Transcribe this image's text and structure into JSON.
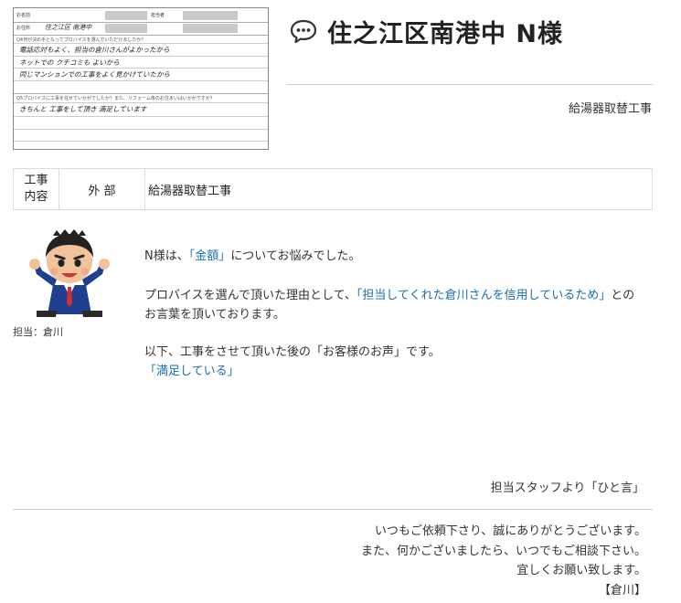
{
  "survey": {
    "q1_label": "Q4何が決め手となってプロバイスを選んでいただけましたか？",
    "answer1_line1": "電話応対もよく、担当の倉川さんがよかったから",
    "answer1_line2": "ネットでの クチコミも よいから",
    "answer1_line3": "同じマンションでの工事をよく見かけていたから",
    "q2_label": "Q5プロバイスに工事を任せていかがでしたか？また、リフォーム後のお住まいはいかがですか？",
    "answer2_line1": "きちんと 工事をして頂き 満足しています",
    "name_label": "お名前",
    "address_label": "お住所",
    "address_value": "住之江区 南港中",
    "contractor_label": "担当者"
  },
  "header": {
    "title": "住之江区南港中 N様",
    "work_type": "給湯器取替工事"
  },
  "info_table": {
    "label_line1": "工事",
    "label_line2": "内容",
    "category": "外 部",
    "detail": "給湯器取替工事"
  },
  "staff": {
    "caption": "担当：倉川"
  },
  "message": {
    "p1_pre": "N様は、",
    "p1_blue": "「金額」",
    "p1_post": "についてお悩みでした。",
    "p2_pre": "プロバイスを選んで頂いた理由として、",
    "p2_blue": "「担当してくれた倉川さんを信用しているため」",
    "p2_post": "との",
    "p2_line2": "お言葉を頂いております。",
    "p3_line1": "以下、工事をさせて頂いた後の「お客様のお声」です。",
    "p3_blue": "「満足している」"
  },
  "footer": {
    "lead": "担当スタッフより「ひと言」",
    "line1": "いつもご依頼下さり、誠にありがとうございます。",
    "line2": "また、何かございましたら、いつでもご相談下さい。",
    "line3": "宜しくお願い致します。",
    "signature": "【倉川】"
  },
  "colors": {
    "accent_blue": "#1a6fb3"
  }
}
